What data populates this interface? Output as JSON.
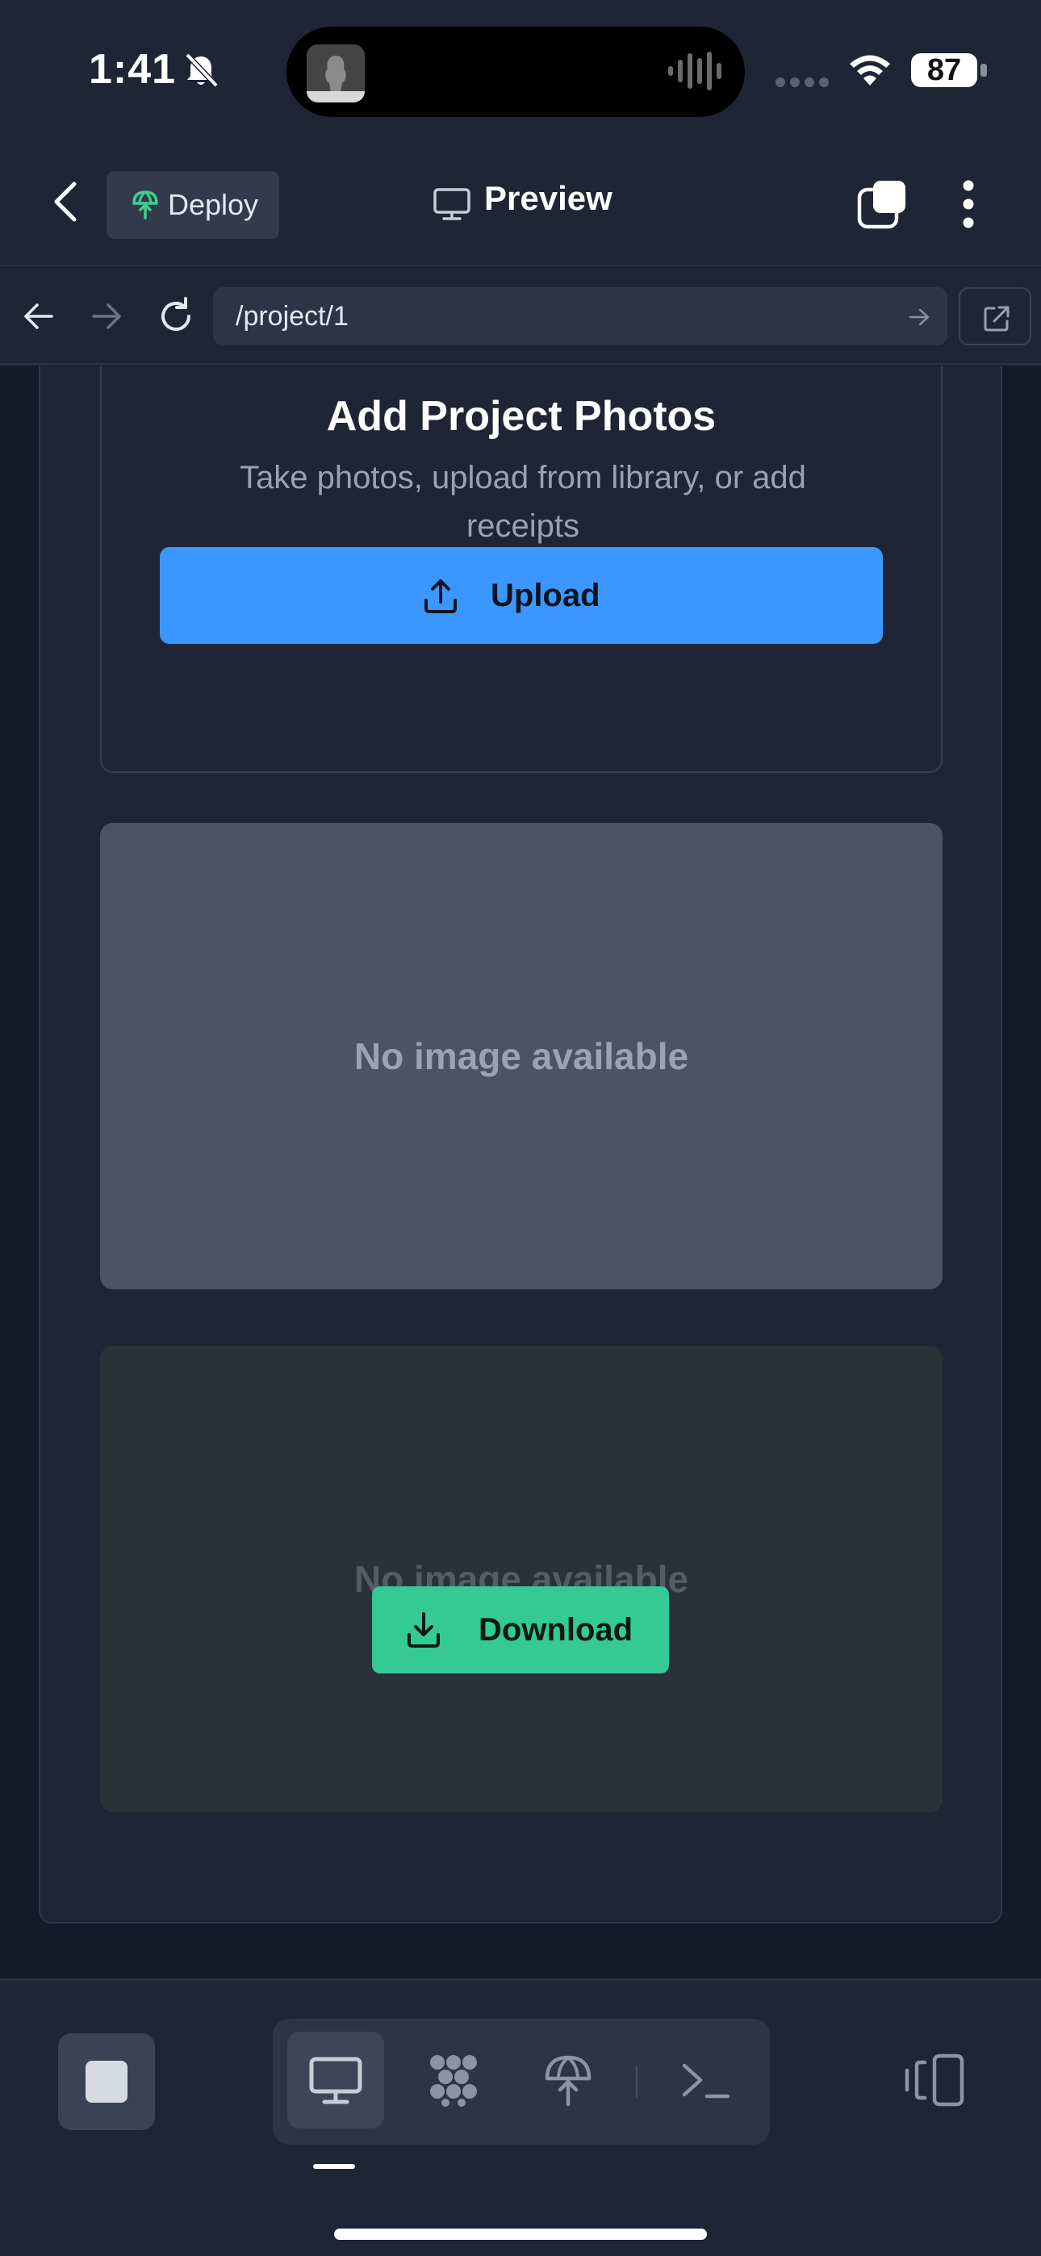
{
  "status_bar": {
    "time": "1:41",
    "battery_percent": "87"
  },
  "header": {
    "deploy_label": "Deploy",
    "title": "Preview"
  },
  "browser": {
    "url": "/project/1"
  },
  "upload_section": {
    "title": "Add Project Photos",
    "description": "Take photos, upload from library, or add receipts",
    "button_label": "Upload"
  },
  "gallery": {
    "items": [
      {
        "placeholder_text": "No image available"
      },
      {
        "placeholder_text": "No image available"
      }
    ],
    "download_label": "Download"
  },
  "colors": {
    "accent_blue": "#3b97ff",
    "accent_green": "#34c995",
    "deploy_icon_green": "#3fcf8e"
  },
  "toolbar": {
    "icons": [
      "stop-icon",
      "monitor-icon",
      "flows-icon",
      "deploy-icon",
      "terminal-icon",
      "rotate-device-icon"
    ]
  }
}
